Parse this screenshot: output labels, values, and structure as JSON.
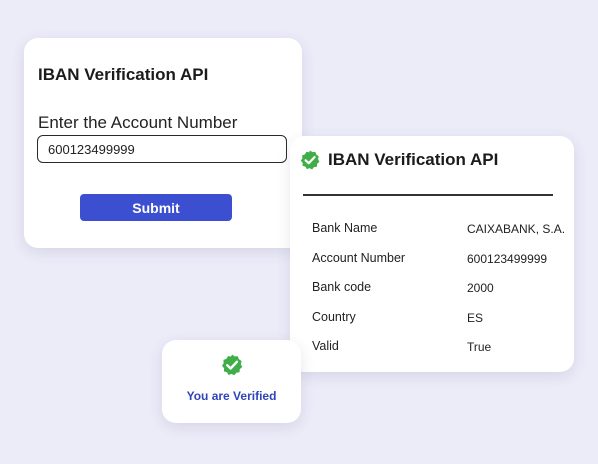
{
  "form": {
    "title": "IBAN Verification API",
    "label": "Enter the Account Number",
    "account_number_value": "600123499999",
    "submit_label": "Submit"
  },
  "result": {
    "title": "IBAN Verification API",
    "rows": [
      {
        "label": "Bank Name",
        "value": "CAIXABANK, S.A."
      },
      {
        "label": "Account Number",
        "value": "600123499999"
      },
      {
        "label": "Bank code",
        "value": "2000"
      },
      {
        "label": "Country",
        "value": "ES"
      },
      {
        "label": "Valid",
        "value": "True"
      }
    ]
  },
  "verified": {
    "text": "You are Verified"
  },
  "icons": {
    "result_badge": "verified-check-badge-icon",
    "verified_badge": "verified-check-badge-icon"
  },
  "colors": {
    "accent": "#3c4fd0",
    "verified_text": "#2f45b9",
    "badge_green": "#3fae49",
    "background": "#ecebf8"
  }
}
